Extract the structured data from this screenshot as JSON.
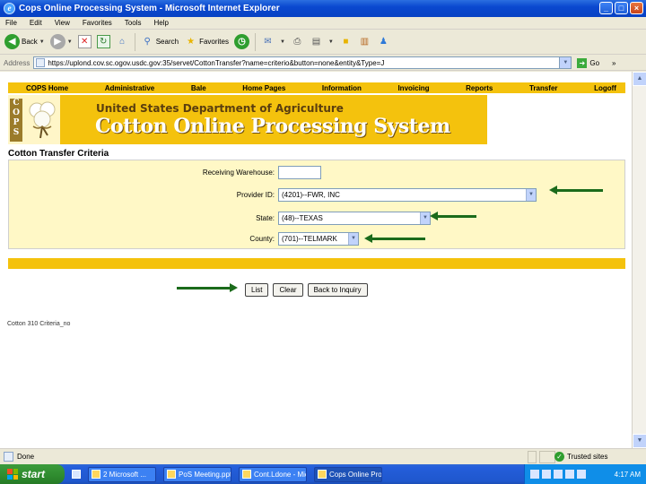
{
  "window": {
    "title": "Cops Online Processing System - Microsoft Internet Explorer",
    "btn_min": "_",
    "btn_max": "□",
    "btn_close": "×"
  },
  "menu": [
    "File",
    "Edit",
    "View",
    "Favorites",
    "Tools",
    "Help"
  ],
  "toolbar": {
    "back": "Back",
    "search": "Search",
    "favorites": "Favorites"
  },
  "address": {
    "label": "Address",
    "url": "https://uplond.cov.sc.ogov.usdc.gov:35/servet/CottonTransfer?name=criterio&button=none&entity&Type=J",
    "go": "Go",
    "links": "»"
  },
  "nav": [
    "COPS Home",
    "Administrative",
    "Bale",
    "Home Pages",
    "Information",
    "Invoicing",
    "Reports",
    "Transfer",
    "Logoff"
  ],
  "banner": {
    "logo_letters": [
      "C",
      "O",
      "P",
      "S"
    ],
    "department": "United States Department of Agriculture",
    "system": "Cotton Online Processing System"
  },
  "page_title": "Cotton Transfer Criteria",
  "form": {
    "warehouse_label": "Receiving Warehouse:",
    "warehouse_value": "",
    "provider_label": "Provider ID:",
    "provider_value": "(4201)--FWR, INC",
    "state_label": "State:",
    "state_value": "(48)--TEXAS",
    "county_label": "County:",
    "county_value": "(701)--TELMARK"
  },
  "buttons": {
    "list": "List",
    "clear": "Clear",
    "back_inquiry": "Back to Inquiry"
  },
  "footer_text": "Cotton 310 Criteria_no",
  "status": {
    "text": "Done",
    "zone": "Trusted sites"
  },
  "taskbar": {
    "start": "start",
    "tasks": [
      "2 Microsoft ...",
      "PoS Meeting.ppt",
      "Cont.Ldone - Mic...",
      "Cops Online Pro..."
    ],
    "clock": "4:17 AM"
  },
  "colors": {
    "cops_gold": "#f4c20d",
    "criteria_bg": "#fff8c6",
    "arrow_green": "#1b6b1b"
  }
}
